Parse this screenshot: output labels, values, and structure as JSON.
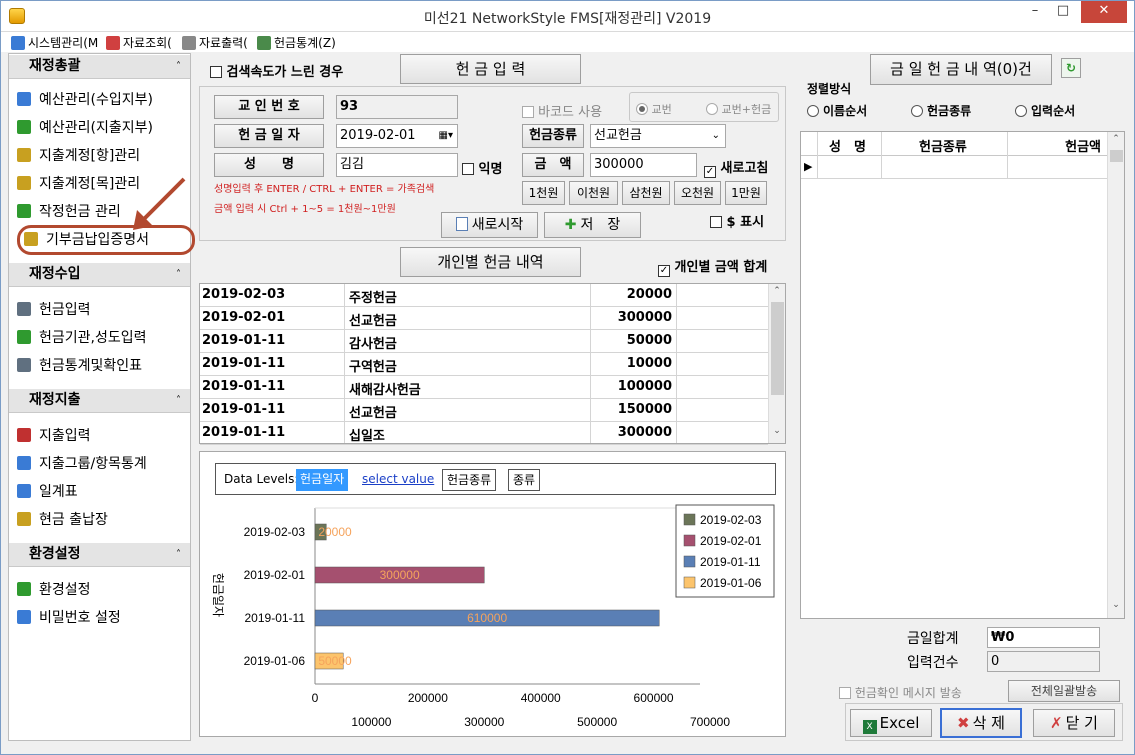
{
  "window": {
    "title": "미선21 NetworkStyle FMS[재정관리] V2019"
  },
  "menu": [
    {
      "label": "시스템관리(M",
      "icon": "system-icon",
      "color": "#3a7bd5"
    },
    {
      "label": "자료조회(",
      "icon": "table-icon",
      "color": "#d04040"
    },
    {
      "label": "자료출력(",
      "icon": "printer-icon",
      "color": "#888888"
    },
    {
      "label": "헌금통계(Z)",
      "icon": "stats-icon",
      "color": "#4a8a4a"
    }
  ],
  "sidebar": {
    "sections": [
      {
        "title": "재정총괄",
        "items": [
          {
            "label": "예산관리(수입지부)",
            "icon": "budget-income-icon",
            "color": "#3a7bd5"
          },
          {
            "label": "예산관리(지출지부)",
            "icon": "budget-expense-icon",
            "color": "#2f9a2f"
          },
          {
            "label": "지출계정[항]관리",
            "icon": "account-item-icon",
            "color": "#c8a020"
          },
          {
            "label": "지출계정[목]관리",
            "icon": "account-detail-icon",
            "color": "#c8a020"
          },
          {
            "label": "작정헌금 관리",
            "icon": "pledge-icon",
            "color": "#2f9a2f"
          },
          {
            "label": "기부금납입증명서",
            "icon": "certificate-icon",
            "color": "#c8a020"
          }
        ]
      },
      {
        "title": "재정수입",
        "items": [
          {
            "label": "헌금입력",
            "icon": "offering-input-icon",
            "color": "#607080"
          },
          {
            "label": "헌금기관,성도입력",
            "icon": "member-input-icon",
            "color": "#2f9a2f"
          },
          {
            "label": "헌금통계및확인표",
            "icon": "offering-stats-icon",
            "color": "#607080"
          }
        ]
      },
      {
        "title": "재정지출",
        "items": [
          {
            "label": "지출입력",
            "icon": "expense-input-icon",
            "color": "#c03030"
          },
          {
            "label": "지출그룹/항목통계",
            "icon": "expense-stats-icon",
            "color": "#3a7bd5"
          },
          {
            "label": "일계표",
            "icon": "daily-report-icon",
            "color": "#3a7bd5"
          },
          {
            "label": "현금 출납장",
            "icon": "cashbook-icon",
            "color": "#c8a020"
          }
        ]
      },
      {
        "title": "환경설정",
        "items": [
          {
            "label": "환경설정",
            "icon": "settings-icon",
            "color": "#2f9a2f"
          },
          {
            "label": "비밀번호 설정",
            "icon": "lock-icon",
            "color": "#3a7bd5"
          }
        ]
      }
    ]
  },
  "form": {
    "slow_search_label": "검색속도가 느린 경우",
    "offering_input_button": "헌 금 입 력",
    "member_no_label": "교 인 번 호",
    "member_no_value": "93",
    "date_label": "헌 금 일 자",
    "date_value": "2019-02-01",
    "name_label": "성　　명",
    "name_value": "김김",
    "anonymous_label": "익명",
    "barcode_label": "바코드 사용",
    "radio_member_no": "교번",
    "radio_member_no_amount": "교번+헌금",
    "offering_type_label": "헌금종류",
    "offering_type_value": "선교헌금",
    "amount_label": "금　액",
    "amount_value": "300000",
    "refresh_label": "새로고침",
    "note1": "성명입력 후 ENTER / CTRL + ENTER = 가족검색",
    "note2": "금액 입력 시 Ctrl + 1~5 = 1천원~1만원",
    "quick_amounts": [
      "1천원",
      "이천원",
      "삼천원",
      "오천원",
      "1만원"
    ],
    "new_start_button": "새로시작",
    "save_button": "저　장",
    "dollar_label": "$ 표시",
    "personal_history_button": "개인별 헌금 내역",
    "personal_total_label": "개인별 금액 합계"
  },
  "history": [
    {
      "date": "2019-02-03",
      "type": "주정헌금",
      "amount": "20000"
    },
    {
      "date": "2019-02-01",
      "type": "선교헌금",
      "amount": "300000"
    },
    {
      "date": "2019-01-11",
      "type": "감사헌금",
      "amount": "50000"
    },
    {
      "date": "2019-01-11",
      "type": "구역헌금",
      "amount": "10000"
    },
    {
      "date": "2019-01-11",
      "type": "새해감사헌금",
      "amount": "100000"
    },
    {
      "date": "2019-01-11",
      "type": "선교헌금",
      "amount": "150000"
    },
    {
      "date": "2019-01-11",
      "type": "십일조",
      "amount": "300000"
    }
  ],
  "chart_controls": {
    "levels_label": "Data Levels:",
    "level_active": "헌금일자",
    "level_link": "select value",
    "level_type": "헌금종류",
    "level_kind": "종류"
  },
  "chart_data": {
    "type": "bar",
    "orientation": "horizontal",
    "categories": [
      "2019-02-03",
      "2019-02-01",
      "2019-01-11",
      "2019-01-06"
    ],
    "values": [
      20000,
      300000,
      610000,
      50000
    ],
    "colors": [
      "#6b7558",
      "#a5506f",
      "#5a7fb5",
      "#fcc46c"
    ],
    "data_labels": [
      "20000",
      "300000",
      "610000",
      "50000"
    ],
    "ylabel": "헌금일자",
    "xlim": [
      0,
      700000
    ],
    "ticks_top": [
      "0",
      "200000",
      "400000",
      "600000"
    ],
    "ticks_bottom": [
      "100000",
      "300000",
      "500000",
      "700000"
    ],
    "legend": [
      "2019-02-03",
      "2019-02-01",
      "2019-01-11",
      "2019-01-06"
    ],
    "legend_position": "top-right",
    "grid": false
  },
  "right_panel": {
    "today_list_button": "금 일 헌 금 내 역(0)건",
    "sort_title": "정렬방식",
    "sort_options": [
      "이름순서",
      "헌금종류",
      "입력순서"
    ],
    "columns": [
      "성　명",
      "헌금종류",
      "헌금액"
    ],
    "today_total_label": "금일합계",
    "today_total_value": "₩0",
    "entry_count_label": "입력건수",
    "entry_count_value": "0",
    "confirm_msg_label": "헌금확인 메시지 발송",
    "bulk_send_button": "전체일괄발송",
    "excel_button": "Excel",
    "delete_button": "삭 제",
    "close_button": "닫 기"
  }
}
